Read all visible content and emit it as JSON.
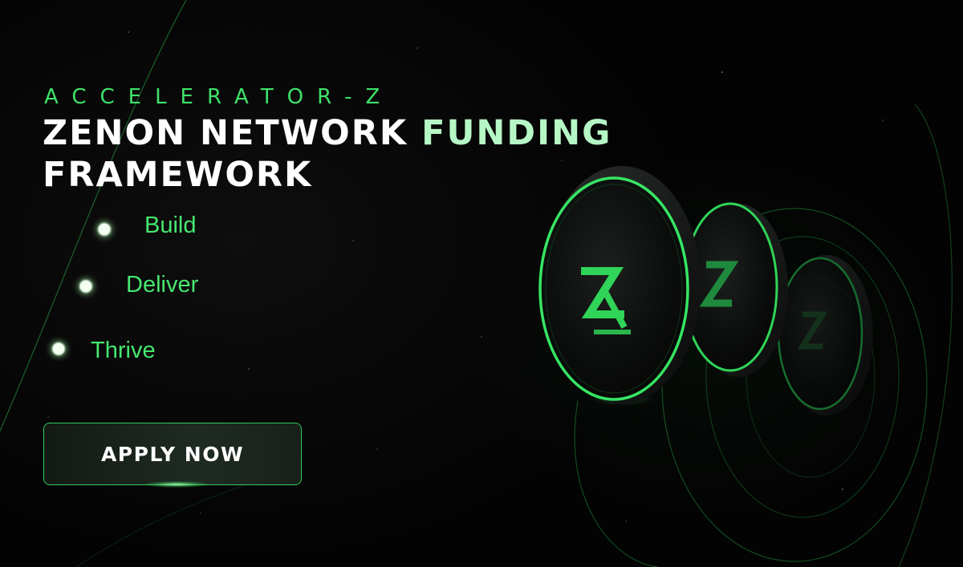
{
  "banner": {
    "eyebrow": "ACCELERATOR-Z",
    "title_white": "ZENON NETWORK ",
    "title_accent": "FUNDING",
    "title_line2": "FRAMEWORK",
    "steps": [
      {
        "label": "Build"
      },
      {
        "label": "Deliver"
      },
      {
        "label": "Thrive"
      }
    ],
    "cta_label": "APPLY NOW",
    "coin_icon": "zenon-z-logo-icon"
  },
  "colors": {
    "background": "#030303",
    "brand_green": "#3ee26a",
    "accent_mint": "#b6f7c6",
    "text_white": "#ffffff"
  }
}
